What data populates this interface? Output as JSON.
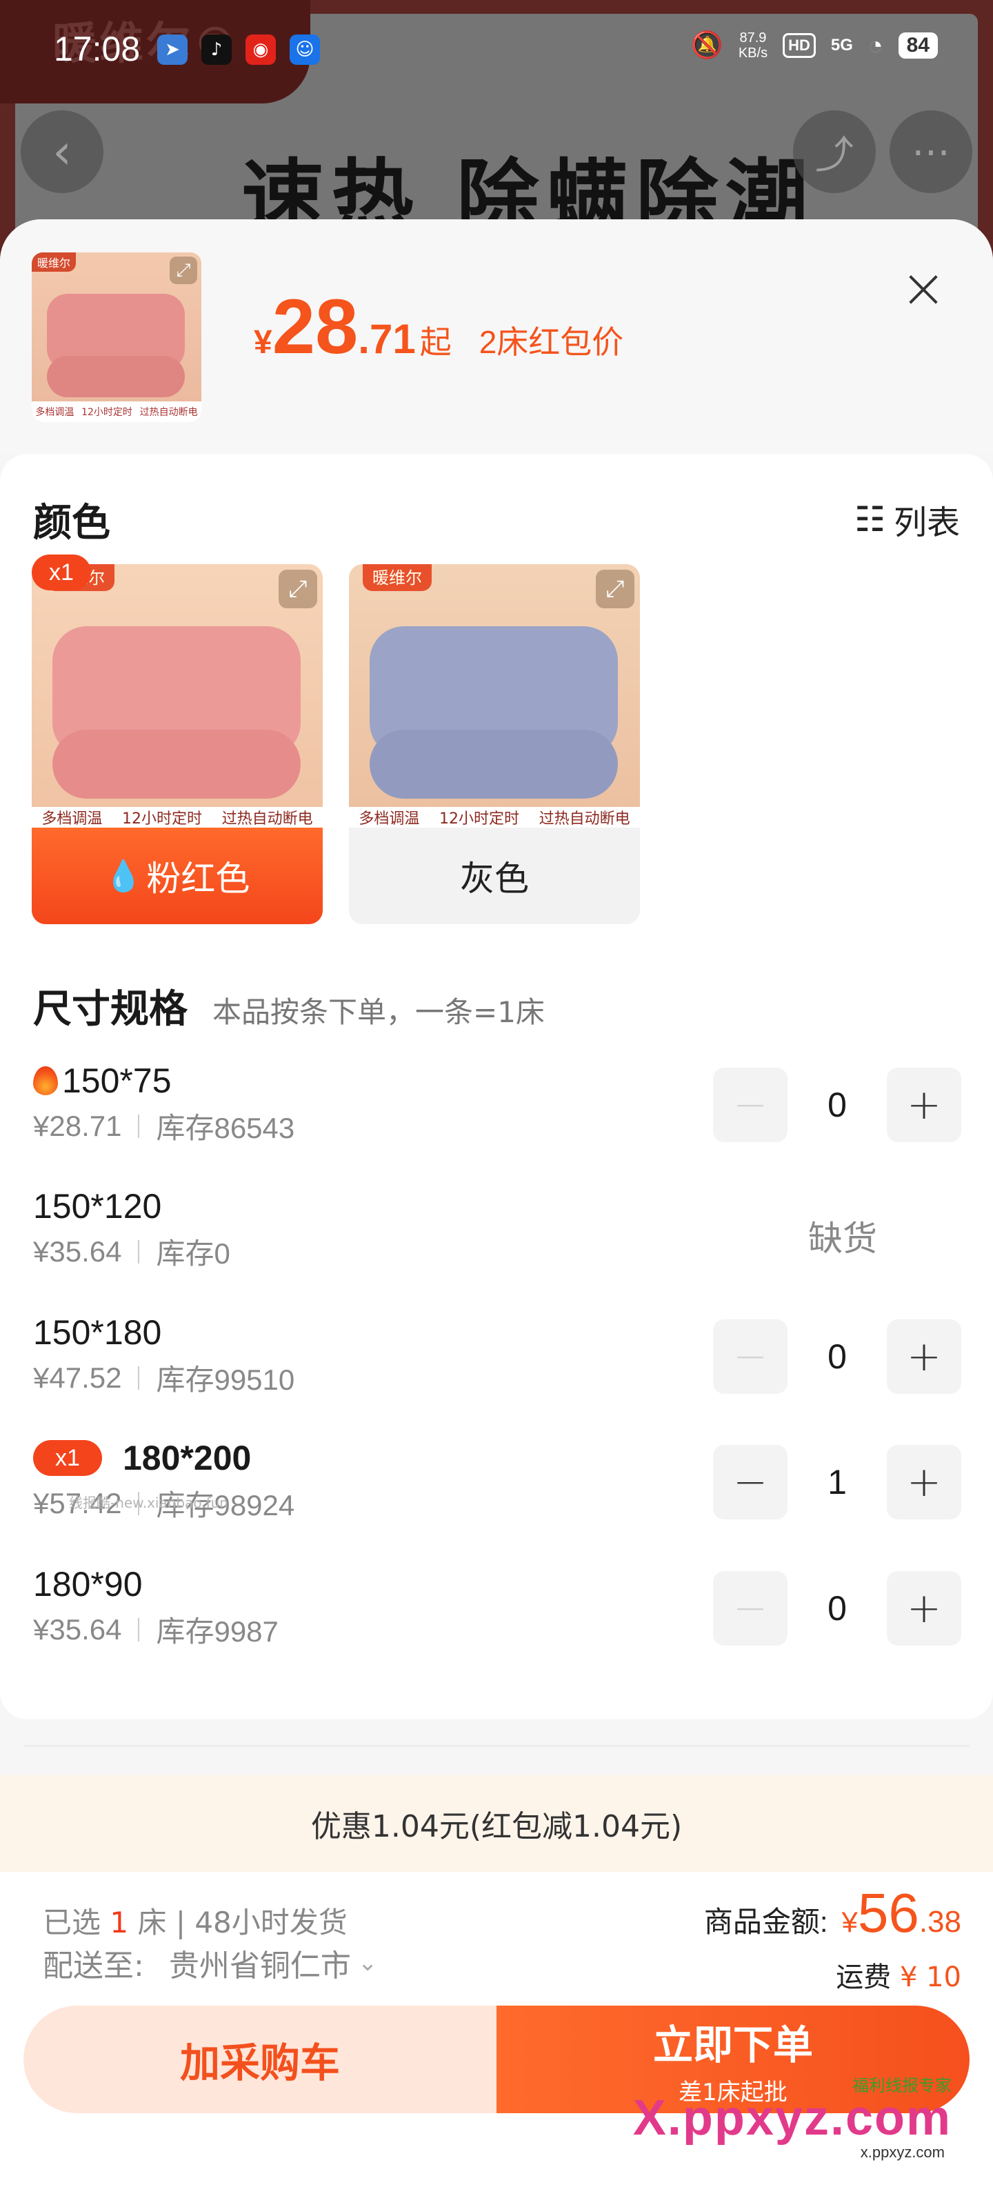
{
  "status_bar": {
    "time": "17:08",
    "speed": "87.9",
    "speed_unit": "KB/s",
    "hd": "HD",
    "network": "5G",
    "battery": "84"
  },
  "background": {
    "brand": "暖维尔®",
    "headline": "速热 除螨除潮"
  },
  "header": {
    "currency": "¥",
    "price_int": "28",
    "price_dec": ".71",
    "price_suffix": "起",
    "price_tag": "2床红包价",
    "thumb_brand": "暖维尔",
    "thumb_strip": [
      "多档调温",
      "12小时定时",
      "过热自动断电"
    ]
  },
  "colors": {
    "title": "颜色",
    "list_label": "列表",
    "options": [
      {
        "label": "粉红色",
        "selected": true,
        "badge": "x1",
        "brand": "暖维尔",
        "strip": [
          "多档调温",
          "12小时定时",
          "过热自动断电"
        ]
      },
      {
        "label": "灰色",
        "selected": false,
        "brand": "暖维尔",
        "strip": [
          "多档调温",
          "12小时定时",
          "过热自动断电"
        ]
      }
    ]
  },
  "sizes": {
    "title": "尺寸规格",
    "note": "本品按条下单，一条=1床",
    "out_of_stock_label": "缺货",
    "rows": [
      {
        "name": "150*75",
        "price": "¥28.71",
        "stock": "库存86543",
        "qty": "0",
        "hot": true
      },
      {
        "name": "150*120",
        "price": "¥35.64",
        "stock": "库存0",
        "qty": null,
        "out_of_stock": true
      },
      {
        "name": "150*180",
        "price": "¥47.52",
        "stock": "库存99510",
        "qty": "0"
      },
      {
        "name": "180*200",
        "price": "¥57.42",
        "stock": "库存98924",
        "qty": "1",
        "badge": "x1"
      },
      {
        "name": "180*90",
        "price": "¥35.64",
        "stock": "库存9987",
        "qty": "0"
      }
    ],
    "minus": "−",
    "plus": "+"
  },
  "watermark": "线报酷-new.xianbao.fun",
  "promo": "优惠1.04元(红包减1.04元)",
  "footer": {
    "selected_prefix": "已选",
    "selected_count": "1",
    "selected_suffix": "床 | 48小时发货",
    "ship_to_label": "配送至:",
    "ship_to_value": "贵州省铜仁市",
    "total_label": "商品金额:",
    "total_currency": "¥",
    "total_int": "56",
    "total_dec": ".38",
    "freight_label": "运费",
    "freight_value": "¥ 10",
    "cart_button": "加采购车",
    "buy_button": "立即下单",
    "buy_sub": "差1床起批"
  },
  "brand_mark": {
    "big": "X.ppxyz.com",
    "small": "福利线报专家",
    "url": "x.ppxyz.com"
  },
  "colors_theme": {
    "accent": "#f5541c",
    "cart_bg": "#ffe6da",
    "promo_bg": "#fdf4ea"
  }
}
